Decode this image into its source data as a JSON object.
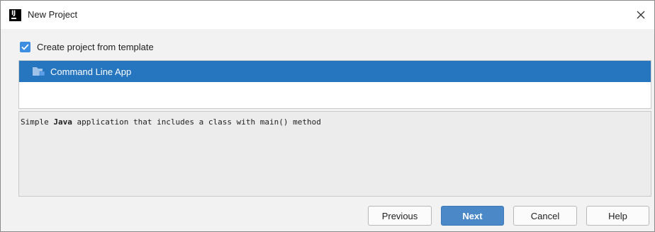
{
  "window": {
    "title": "New Project"
  },
  "create_from_template": {
    "label": "Create project from template",
    "checked": true
  },
  "template_list": {
    "items": [
      {
        "label": "Command Line App",
        "selected": true
      }
    ]
  },
  "description": {
    "prefix": "Simple ",
    "emphasis": "Java",
    "suffix": " application that includes a class with main() method"
  },
  "buttons": {
    "previous": "Previous",
    "next": "Next",
    "cancel": "Cancel",
    "help": "Help"
  },
  "colors": {
    "accent": "#2675bf",
    "primary_button": "#4a88c7",
    "checkbox": "#3d8ee0"
  },
  "icons": {
    "app": "intellij-logo-icon",
    "close": "close-icon",
    "template": "folder-icon",
    "check": "checkmark-icon"
  }
}
